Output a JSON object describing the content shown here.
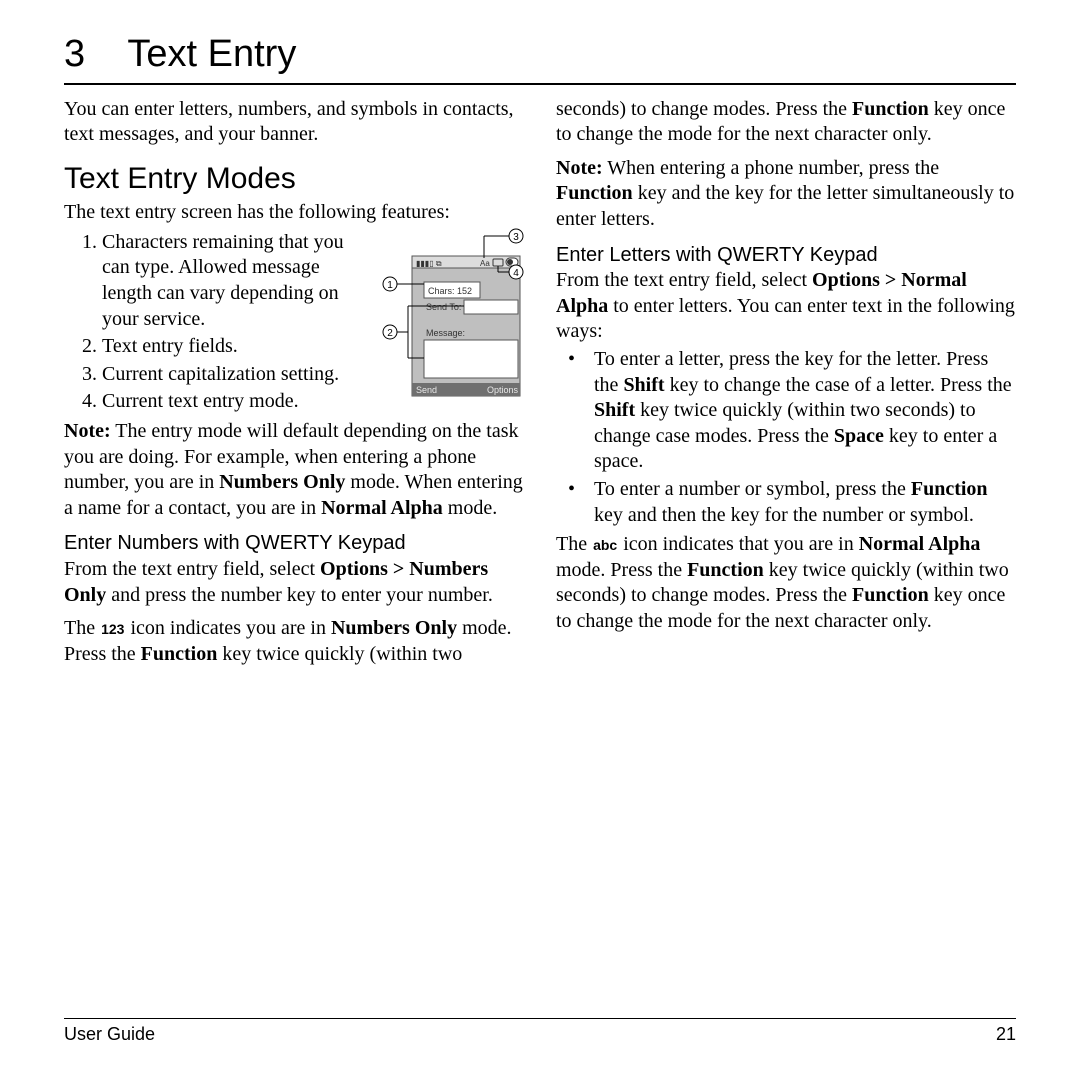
{
  "chapter": {
    "number": "3",
    "title": "Text Entry"
  },
  "intro": "You can enter letters, numbers, and symbols in contacts, text messages, and your banner.",
  "section1": {
    "heading": "Text Entry Modes",
    "lead": "The text entry screen has the following features:",
    "items": [
      "Characters remaining that you can type. Allowed message length can vary depending on your service.",
      "Text entry fields.",
      "Current capitalization setting.",
      "Current text entry mode."
    ],
    "note": {
      "label": "Note:",
      "a": " The entry mode will default depending on the task you are doing. For example, when entering a phone number, you are in ",
      "b": "Numbers Only",
      "c": " mode. When entering a name for a contact, you are in ",
      "d": "Normal Alpha",
      "e": " mode."
    }
  },
  "sectionNumbers": {
    "heading": "Enter Numbers with QWERTY Keypad",
    "p": {
      "a": "From the text entry field, select ",
      "b": "Options > Numbers Only",
      "c": " and press the number key to enter your number."
    },
    "icon_para": {
      "a": "The ",
      "icon": "123",
      "b": " icon indicates you are in ",
      "c": "Numbers Only",
      "d": " mode. Press the ",
      "e": "Function",
      "f": " key twice quickly (within two seconds) to change modes. Press the ",
      "g": "Function",
      "h": " key once to change the mode for the next character only."
    },
    "note": {
      "label": "Note:",
      "a": " When entering a phone number, press the ",
      "b": "Function",
      "c": " key and the key for the letter simultaneously to enter letters."
    }
  },
  "sectionLetters": {
    "heading": "Enter Letters with QWERTY Keypad",
    "p": {
      "a": "From the text entry field, select ",
      "b": "Options > Normal Alpha",
      "c": " to enter letters. You can enter text in the following ways:"
    },
    "bullets": [
      {
        "a": "To enter a letter, press the key for the letter. Press the ",
        "b": "Shift",
        "c": " key to change the case of a letter. Press the ",
        "d": "Shift",
        "e": " key twice quickly (within two seconds) to change case modes. Press the ",
        "f": "Space",
        "g": " key to enter a space."
      },
      {
        "a": "To enter a number or symbol, press the ",
        "b": "Function",
        "c": " key and then the key for the number or symbol."
      }
    ],
    "icon_para": {
      "a": "The ",
      "icon": "abc",
      "b": " icon indicates that you are in ",
      "c": "Normal Alpha",
      "d": " mode. Press the ",
      "e": "Function",
      "f": " key twice quickly (within two seconds) to change modes. Press the ",
      "g": "Function",
      "h": " key once to change the mode for the next character only."
    }
  },
  "phone_fig": {
    "chars_label": "Chars: 152",
    "send_to": "Send To:",
    "message": "Message:",
    "aa": "Aa",
    "send": "Send",
    "options": "Options"
  },
  "footer": {
    "left": "User Guide",
    "right": "21"
  }
}
